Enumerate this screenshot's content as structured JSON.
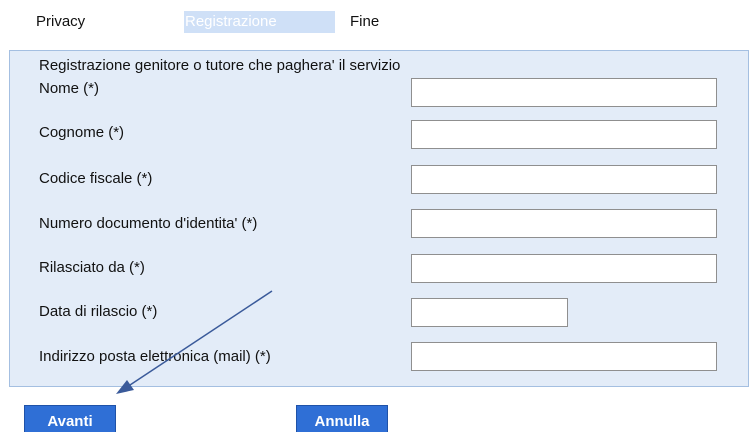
{
  "steps": {
    "privacy": "Privacy",
    "registrazione": "Registrazione",
    "fine": "Fine",
    "active": "registrazione"
  },
  "form": {
    "heading": "Registrazione genitore o tutore che paghera' il servizio",
    "fields": {
      "nome": {
        "label": "Nome (*)",
        "value": ""
      },
      "cognome": {
        "label": "Cognome (*)",
        "value": ""
      },
      "codice_fiscale": {
        "label": "Codice fiscale (*)",
        "value": ""
      },
      "numero_documento": {
        "label": "Numero documento d'identita' (*)",
        "value": ""
      },
      "rilasciato_da": {
        "label": "Rilasciato da (*)",
        "value": ""
      },
      "data_rilascio": {
        "label": "Data di rilascio (*)",
        "value": ""
      },
      "email": {
        "label": "Indirizzo posta elettronica (mail) (*)",
        "value": ""
      }
    }
  },
  "buttons": {
    "avanti": "Avanti",
    "annulla": "Annulla"
  },
  "annotation": {
    "arrow_color": "#3a5a9a",
    "points_to": "avanti-button"
  },
  "colors": {
    "panel_background": "#e3ecf8",
    "panel_border": "#a4bfe1",
    "active_tab_background": "#cfe0f7",
    "button_background": "#2f6fd6"
  }
}
